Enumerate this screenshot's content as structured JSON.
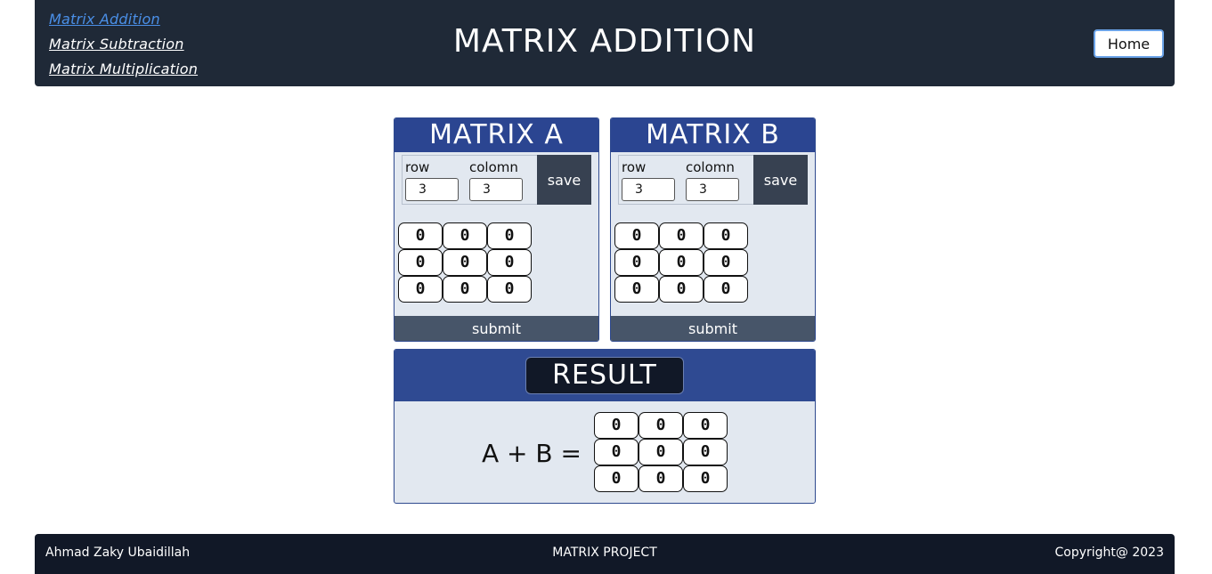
{
  "header": {
    "nav": [
      {
        "label": "Matrix Addition",
        "active": true
      },
      {
        "label": "Matrix Subtraction",
        "active": false
      },
      {
        "label": "Matrix Multiplication",
        "active": false
      }
    ],
    "title": "MATRIX ADDITION",
    "home_label": "Home"
  },
  "matrix_a": {
    "title": "MATRIX A",
    "row_label": "row",
    "col_label": "colomn",
    "rows": "3",
    "cols": "3",
    "save_label": "save",
    "submit_label": "submit",
    "cells": [
      "0",
      "0",
      "0",
      "0",
      "0",
      "0",
      "0",
      "0",
      "0"
    ]
  },
  "matrix_b": {
    "title": "MATRIX B",
    "row_label": "row",
    "col_label": "colomn",
    "rows": "3",
    "cols": "3",
    "save_label": "save",
    "submit_label": "submit",
    "cells": [
      "0",
      "0",
      "0",
      "0",
      "0",
      "0",
      "0",
      "0",
      "0"
    ]
  },
  "result": {
    "title": "RESULT",
    "equation": "A + B =",
    "cells": [
      "0",
      "0",
      "0",
      "0",
      "0",
      "0",
      "0",
      "0",
      "0"
    ]
  },
  "footer": {
    "author": "Ahmad Zaky Ubaidillah",
    "project": "MATRIX PROJECT",
    "copyright": "Copyright@ 2023"
  },
  "colors": {
    "header_bg": "#1f2937",
    "panel_title_bg": "#2b4591",
    "panel_bg": "#e2e8f0",
    "active_link": "#4a8fe7",
    "footer_bg": "#111827"
  }
}
